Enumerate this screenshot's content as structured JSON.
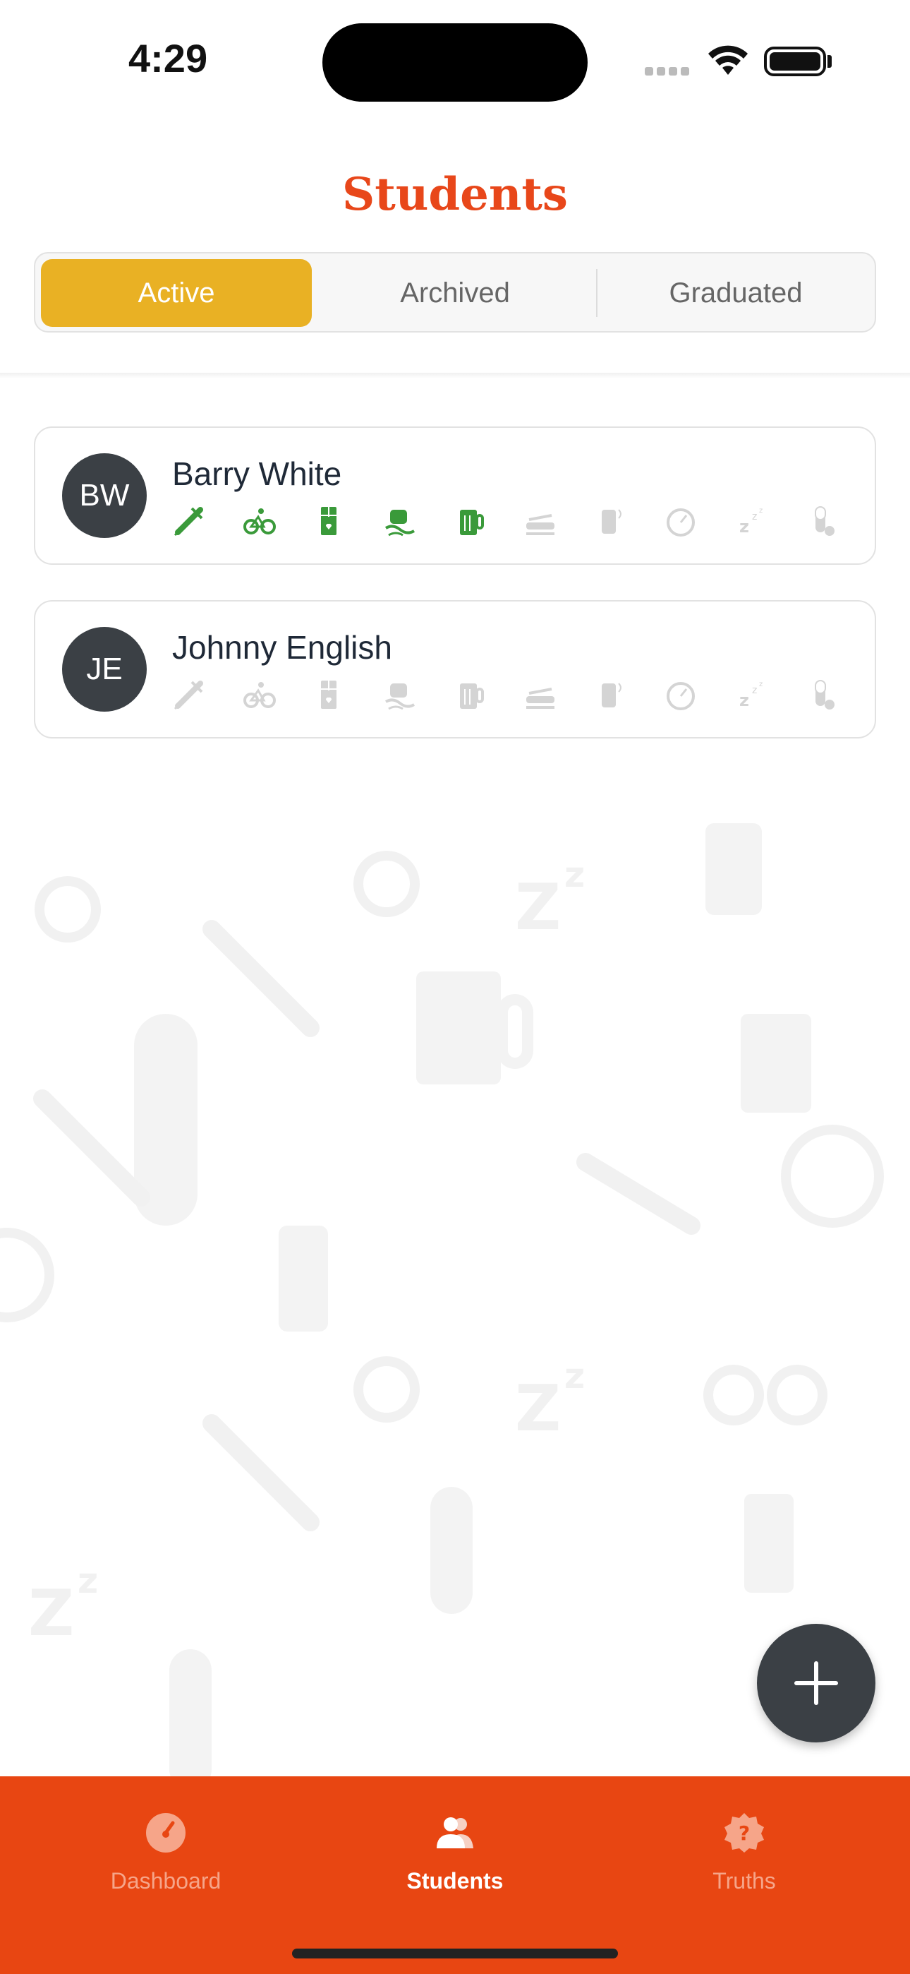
{
  "status_bar": {
    "time": "4:29"
  },
  "page_title": "Students",
  "tabs": [
    {
      "label": "Active",
      "selected": true
    },
    {
      "label": "Archived",
      "selected": false
    },
    {
      "label": "Graduated",
      "selected": false
    }
  ],
  "colors": {
    "brand": "#e84612",
    "active_tab": "#e9b124",
    "icon_active": "#3a9a3a",
    "icon_inactive": "#d4d4d4",
    "avatar": "#3b4045"
  },
  "students": [
    {
      "initials": "BW",
      "name": "Barry White",
      "icons": [
        {
          "name": "syringe-icon",
          "active": true
        },
        {
          "name": "bicycle-icon",
          "active": true
        },
        {
          "name": "chocolate-icon",
          "active": true
        },
        {
          "name": "car-skid-icon",
          "active": true
        },
        {
          "name": "beer-icon",
          "active": true
        },
        {
          "name": "car-crash-icon",
          "active": false
        },
        {
          "name": "phone-icon",
          "active": false
        },
        {
          "name": "speedometer-icon",
          "active": false
        },
        {
          "name": "sleep-icon",
          "active": false
        },
        {
          "name": "pill-icon",
          "active": false
        }
      ]
    },
    {
      "initials": "JE",
      "name": "Johnny English",
      "icons": [
        {
          "name": "syringe-icon",
          "active": false
        },
        {
          "name": "bicycle-icon",
          "active": false
        },
        {
          "name": "chocolate-icon",
          "active": false
        },
        {
          "name": "car-skid-icon",
          "active": false
        },
        {
          "name": "beer-icon",
          "active": false
        },
        {
          "name": "car-crash-icon",
          "active": false
        },
        {
          "name": "phone-icon",
          "active": false
        },
        {
          "name": "speedometer-icon",
          "active": false
        },
        {
          "name": "sleep-icon",
          "active": false
        },
        {
          "name": "pill-icon",
          "active": false
        }
      ]
    }
  ],
  "fab": {
    "icon": "plus-icon"
  },
  "tabbar": [
    {
      "label": "Dashboard",
      "icon": "dashboard-gauge-icon",
      "active": false
    },
    {
      "label": "Students",
      "icon": "students-people-icon",
      "active": true
    },
    {
      "label": "Truths",
      "icon": "truths-question-badge-icon",
      "active": false
    }
  ]
}
